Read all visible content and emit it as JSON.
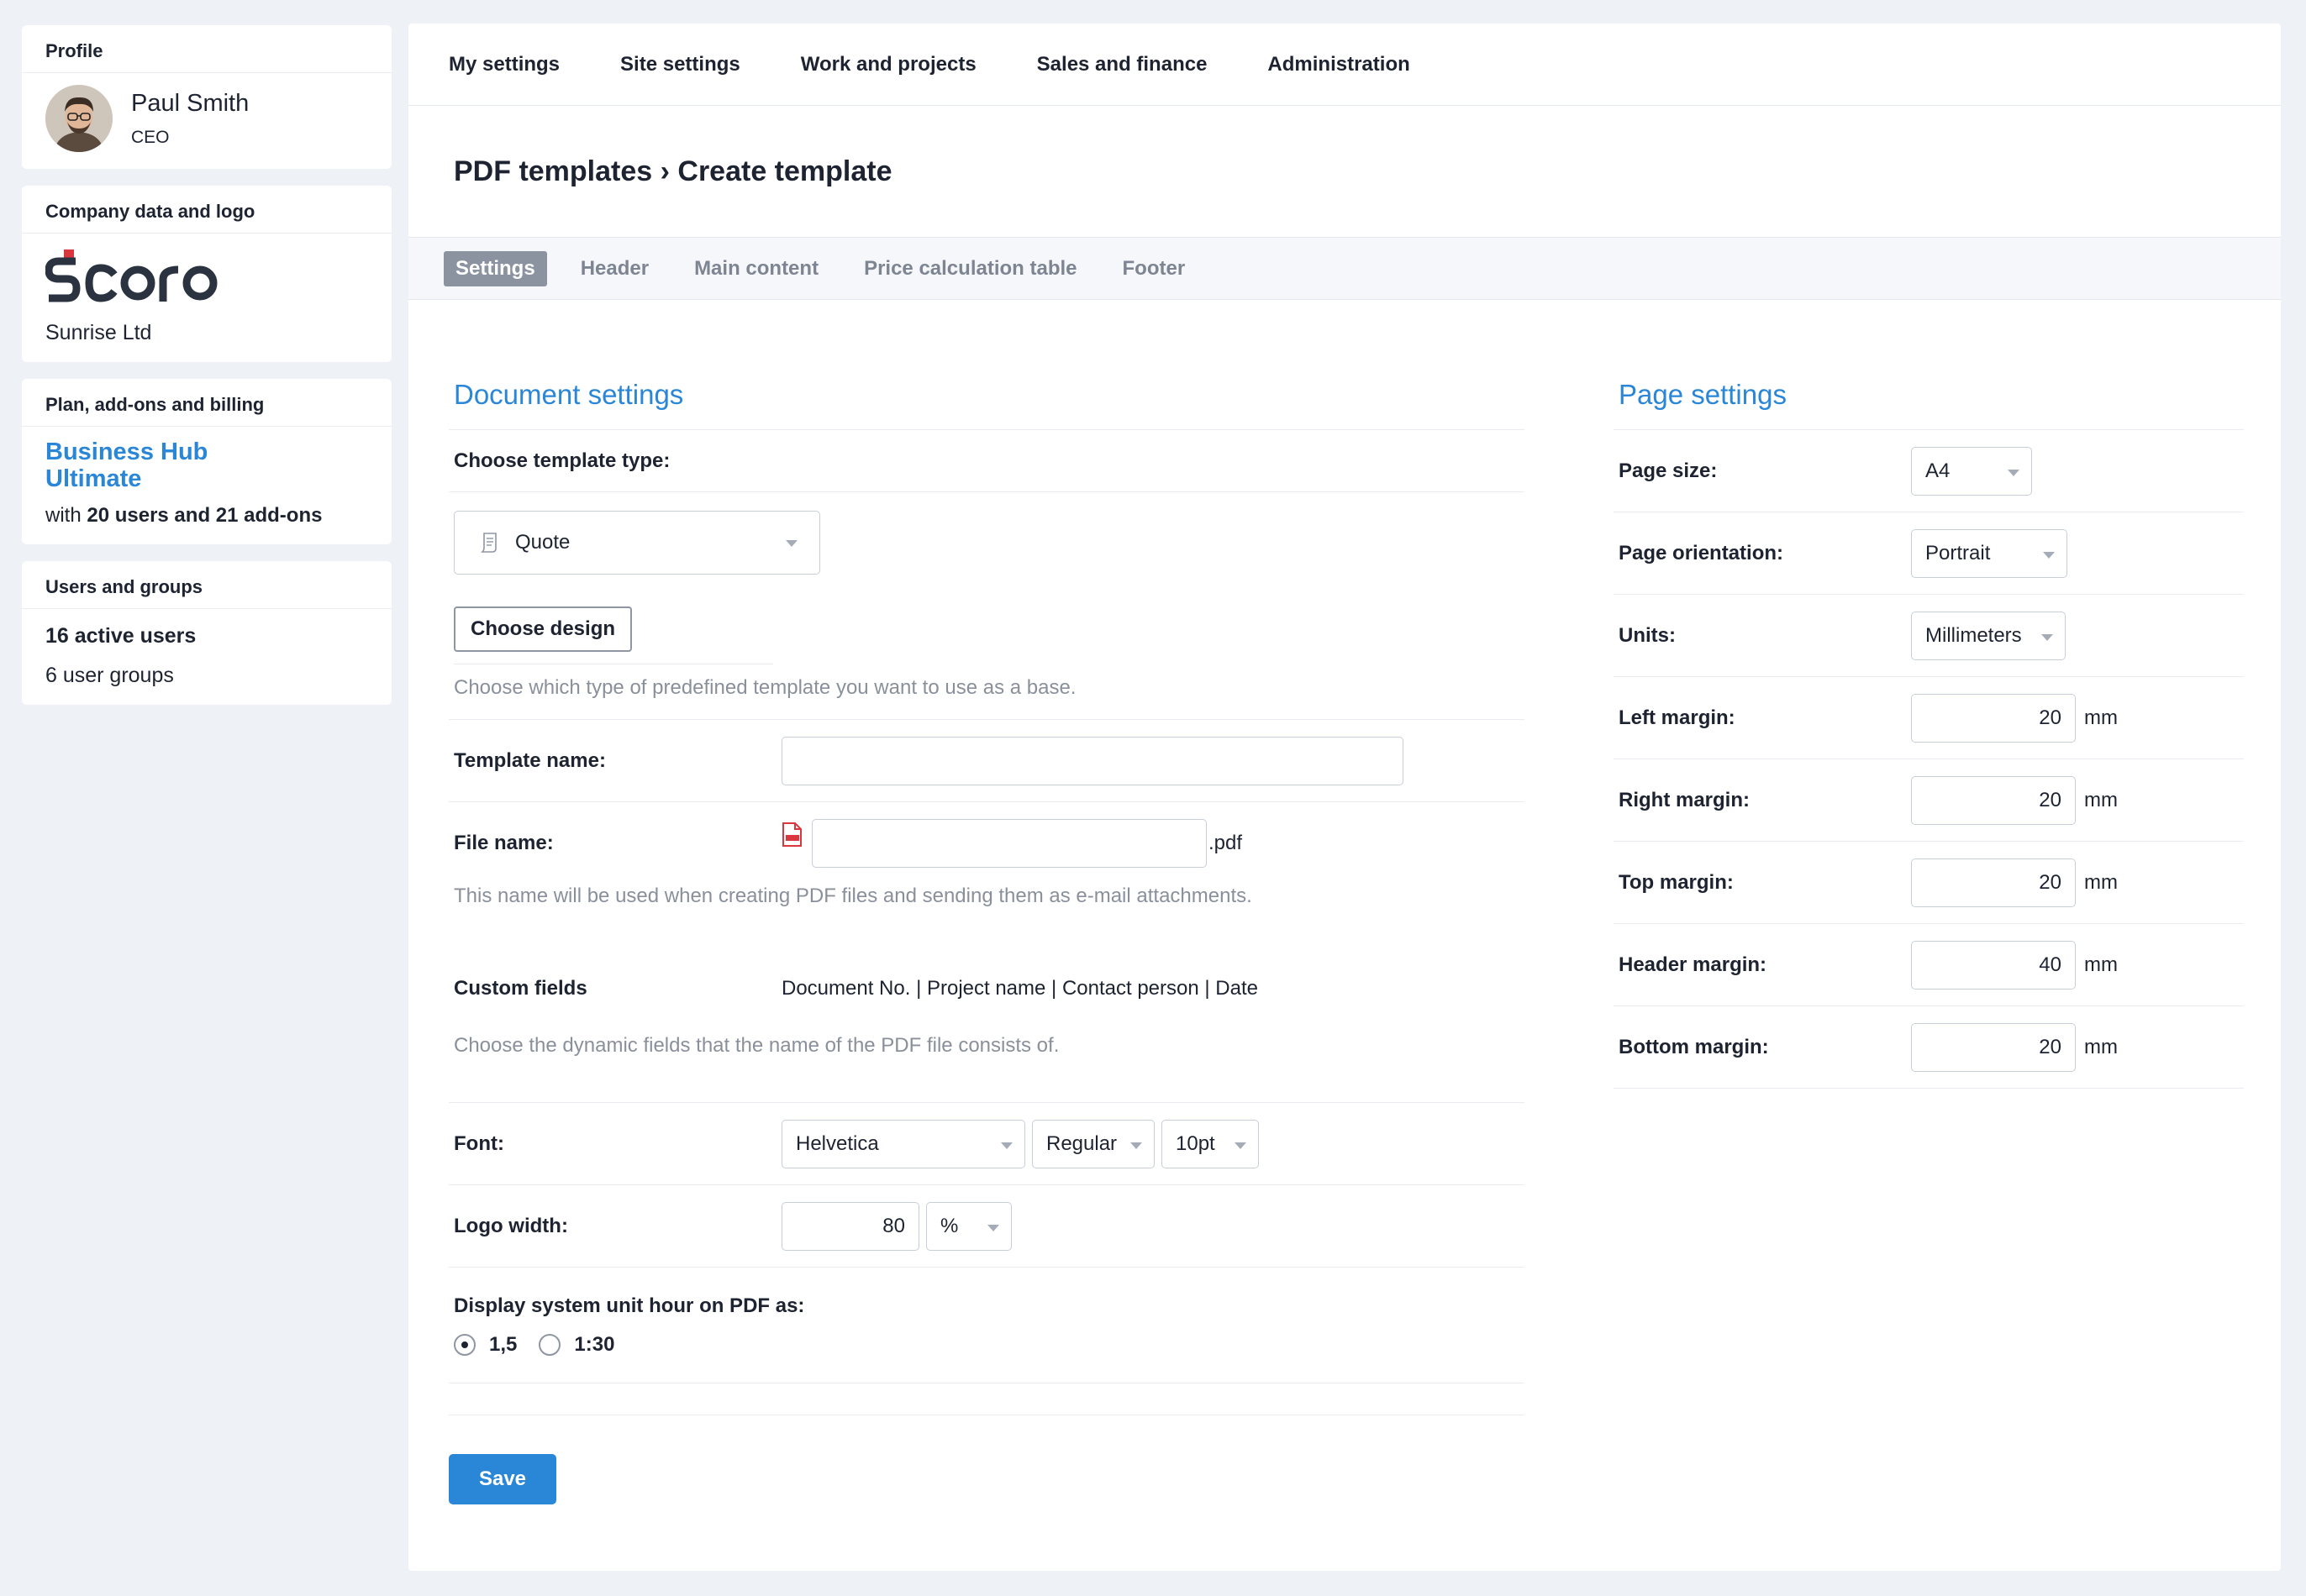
{
  "sidebar": {
    "profile": {
      "title": "Profile",
      "name": "Paul Smith",
      "role": "CEO"
    },
    "company": {
      "title": "Company data and logo",
      "logo_text": "Scoro",
      "name": "Sunrise Ltd"
    },
    "plan": {
      "title": "Plan, add-ons and billing",
      "name_line1": "Business Hub",
      "name_line2": "Ultimate",
      "desc_prefix": "with ",
      "desc_bold": "20 users and 21 add-ons"
    },
    "users": {
      "title": "Users and groups",
      "active": "16 active users",
      "groups": "6 user groups"
    }
  },
  "topnav": [
    "My settings",
    "Site settings",
    "Work and projects",
    "Sales and finance",
    "Administration"
  ],
  "page_title": "PDF templates › Create template",
  "tabs": [
    {
      "label": "Settings",
      "active": true
    },
    {
      "label": "Header",
      "active": false
    },
    {
      "label": "Main content",
      "active": false
    },
    {
      "label": "Price calculation table",
      "active": false
    },
    {
      "label": "Footer",
      "active": false
    }
  ],
  "document": {
    "title": "Document settings",
    "template_type_label": "Choose template type:",
    "template_type_value": "Quote",
    "choose_design": "Choose design",
    "template_help": "Choose which type of predefined template you want to use as a base.",
    "template_name_label": "Template name:",
    "template_name_value": "",
    "file_name_label": "File name:",
    "file_name_value": "",
    "file_ext": ".pdf",
    "file_help": "This name will be used when creating PDF files and sending them as e-mail attachments.",
    "custom_fields_label": "Custom fields",
    "custom_fields_value": "Document No. | Project name | Contact person | Date",
    "custom_fields_help": "Choose the dynamic fields that the name of the PDF file consists of.",
    "font_label": "Font:",
    "font_family": "Helvetica",
    "font_style": "Regular",
    "font_size": "10pt",
    "logo_width_label": "Logo width:",
    "logo_width_value": "80",
    "logo_width_unit": "%",
    "unit_hour_label": "Display system unit hour on PDF as:",
    "unit_hour_options": [
      {
        "label": "1,5",
        "checked": true
      },
      {
        "label": "1:30",
        "checked": false
      }
    ],
    "save": "Save"
  },
  "page": {
    "title": "Page settings",
    "size_label": "Page size:",
    "size_value": "A4",
    "orientation_label": "Page orientation:",
    "orientation_value": "Portrait",
    "units_label": "Units:",
    "units_value": "Millimeters",
    "unit_suffix": "mm",
    "margins": [
      {
        "label": "Left margin:",
        "value": "20"
      },
      {
        "label": "Right margin:",
        "value": "20"
      },
      {
        "label": "Top margin:",
        "value": "20"
      },
      {
        "label": "Header margin:",
        "value": "40"
      },
      {
        "label": "Bottom margin:",
        "value": "20"
      }
    ]
  },
  "colors": {
    "accent": "#2a86d6",
    "pdf_icon": "#d9373d",
    "logo_dark": "#2b3240",
    "logo_red": "#d9373d"
  }
}
